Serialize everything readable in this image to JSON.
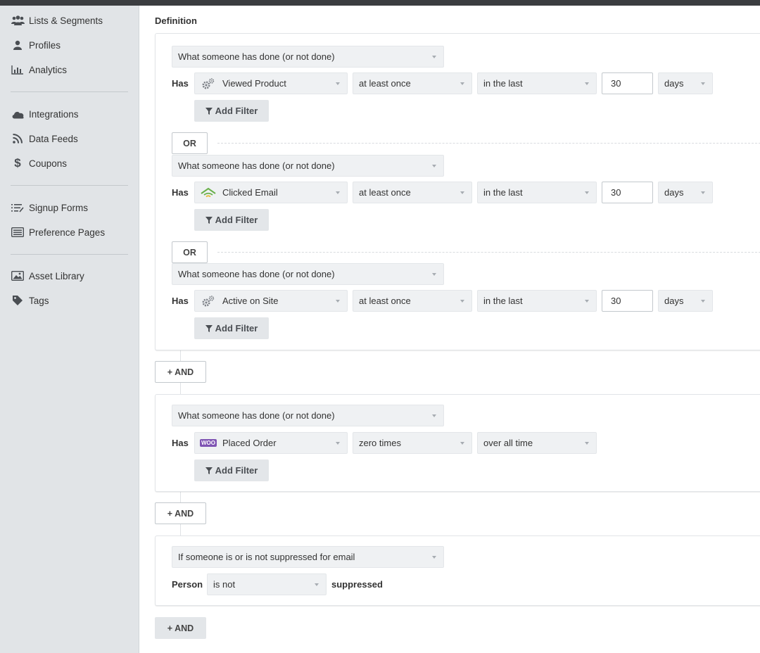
{
  "sidebar": {
    "items": [
      {
        "label": "Lists & Segments",
        "icon": "people-icon"
      },
      {
        "label": "Profiles",
        "icon": "person-icon"
      },
      {
        "label": "Analytics",
        "icon": "bar-chart-icon"
      },
      {
        "label": "Integrations",
        "icon": "cloud-icon"
      },
      {
        "label": "Data Feeds",
        "icon": "rss-icon"
      },
      {
        "label": "Coupons",
        "icon": "dollar-icon"
      },
      {
        "label": "Signup Forms",
        "icon": "form-list-icon"
      },
      {
        "label": "Preference Pages",
        "icon": "preference-page-icon"
      },
      {
        "label": "Asset Library",
        "icon": "image-icon"
      },
      {
        "label": "Tags",
        "icon": "tag-icon"
      }
    ]
  },
  "main": {
    "definition_label": "Definition",
    "has_label": "Has",
    "add_filter_label": "Add Filter",
    "or_label": "OR",
    "and_label": "+ AND",
    "group1": {
      "conditions": [
        {
          "type": "What someone has done (or not done)",
          "metric": "Viewed Product",
          "metric_icon": "api-gears-icon",
          "frequency": "at least once",
          "timeframe": "in the last",
          "amount": "30",
          "unit": "days"
        },
        {
          "type": "What someone has done (or not done)",
          "metric": "Clicked Email",
          "metric_icon": "email-wifi-icon",
          "frequency": "at least once",
          "timeframe": "in the last",
          "amount": "30",
          "unit": "days"
        },
        {
          "type": "What someone has done (or not done)",
          "metric": "Active on Site",
          "metric_icon": "api-gears-icon",
          "frequency": "at least once",
          "timeframe": "in the last",
          "amount": "30",
          "unit": "days"
        }
      ]
    },
    "group2": {
      "condition": {
        "type": "What someone has done (or not done)",
        "metric": "Placed Order",
        "metric_icon": "woo-icon",
        "woo_text": "WOO",
        "frequency": "zero times",
        "timeframe": "over all time"
      }
    },
    "group3": {
      "type": "If someone is or is not suppressed for email",
      "person_label": "Person",
      "operator": "is not",
      "suppressed_label": "suppressed"
    }
  },
  "colors": {
    "sidebar_bg": "#e1e4e7",
    "select_bg": "#eff1f3",
    "clicked_email_green": "#6ab04c",
    "woo_purple": "#7f54b3"
  }
}
